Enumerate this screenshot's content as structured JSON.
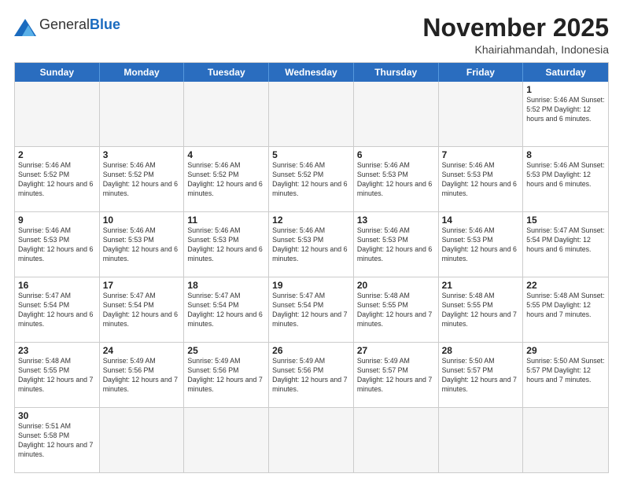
{
  "header": {
    "logo_general": "General",
    "logo_blue": "Blue",
    "month_title": "November 2025",
    "location": "Khairiahmandah, Indonesia"
  },
  "weekdays": [
    "Sunday",
    "Monday",
    "Tuesday",
    "Wednesday",
    "Thursday",
    "Friday",
    "Saturday"
  ],
  "rows": [
    [
      {
        "day": "",
        "info": "",
        "empty": true
      },
      {
        "day": "",
        "info": "",
        "empty": true
      },
      {
        "day": "",
        "info": "",
        "empty": true
      },
      {
        "day": "",
        "info": "",
        "empty": true
      },
      {
        "day": "",
        "info": "",
        "empty": true
      },
      {
        "day": "",
        "info": "",
        "empty": true
      },
      {
        "day": "1",
        "info": "Sunrise: 5:46 AM\nSunset: 5:52 PM\nDaylight: 12 hours\nand 6 minutes."
      }
    ],
    [
      {
        "day": "2",
        "info": "Sunrise: 5:46 AM\nSunset: 5:52 PM\nDaylight: 12 hours\nand 6 minutes."
      },
      {
        "day": "3",
        "info": "Sunrise: 5:46 AM\nSunset: 5:52 PM\nDaylight: 12 hours\nand 6 minutes."
      },
      {
        "day": "4",
        "info": "Sunrise: 5:46 AM\nSunset: 5:52 PM\nDaylight: 12 hours\nand 6 minutes."
      },
      {
        "day": "5",
        "info": "Sunrise: 5:46 AM\nSunset: 5:52 PM\nDaylight: 12 hours\nand 6 minutes."
      },
      {
        "day": "6",
        "info": "Sunrise: 5:46 AM\nSunset: 5:53 PM\nDaylight: 12 hours\nand 6 minutes."
      },
      {
        "day": "7",
        "info": "Sunrise: 5:46 AM\nSunset: 5:53 PM\nDaylight: 12 hours\nand 6 minutes."
      },
      {
        "day": "8",
        "info": "Sunrise: 5:46 AM\nSunset: 5:53 PM\nDaylight: 12 hours\nand 6 minutes."
      }
    ],
    [
      {
        "day": "9",
        "info": "Sunrise: 5:46 AM\nSunset: 5:53 PM\nDaylight: 12 hours\nand 6 minutes."
      },
      {
        "day": "10",
        "info": "Sunrise: 5:46 AM\nSunset: 5:53 PM\nDaylight: 12 hours\nand 6 minutes."
      },
      {
        "day": "11",
        "info": "Sunrise: 5:46 AM\nSunset: 5:53 PM\nDaylight: 12 hours\nand 6 minutes."
      },
      {
        "day": "12",
        "info": "Sunrise: 5:46 AM\nSunset: 5:53 PM\nDaylight: 12 hours\nand 6 minutes."
      },
      {
        "day": "13",
        "info": "Sunrise: 5:46 AM\nSunset: 5:53 PM\nDaylight: 12 hours\nand 6 minutes."
      },
      {
        "day": "14",
        "info": "Sunrise: 5:46 AM\nSunset: 5:53 PM\nDaylight: 12 hours\nand 6 minutes."
      },
      {
        "day": "15",
        "info": "Sunrise: 5:47 AM\nSunset: 5:54 PM\nDaylight: 12 hours\nand 6 minutes."
      }
    ],
    [
      {
        "day": "16",
        "info": "Sunrise: 5:47 AM\nSunset: 5:54 PM\nDaylight: 12 hours\nand 6 minutes."
      },
      {
        "day": "17",
        "info": "Sunrise: 5:47 AM\nSunset: 5:54 PM\nDaylight: 12 hours\nand 6 minutes."
      },
      {
        "day": "18",
        "info": "Sunrise: 5:47 AM\nSunset: 5:54 PM\nDaylight: 12 hours\nand 6 minutes."
      },
      {
        "day": "19",
        "info": "Sunrise: 5:47 AM\nSunset: 5:54 PM\nDaylight: 12 hours\nand 7 minutes."
      },
      {
        "day": "20",
        "info": "Sunrise: 5:48 AM\nSunset: 5:55 PM\nDaylight: 12 hours\nand 7 minutes."
      },
      {
        "day": "21",
        "info": "Sunrise: 5:48 AM\nSunset: 5:55 PM\nDaylight: 12 hours\nand 7 minutes."
      },
      {
        "day": "22",
        "info": "Sunrise: 5:48 AM\nSunset: 5:55 PM\nDaylight: 12 hours\nand 7 minutes."
      }
    ],
    [
      {
        "day": "23",
        "info": "Sunrise: 5:48 AM\nSunset: 5:55 PM\nDaylight: 12 hours\nand 7 minutes."
      },
      {
        "day": "24",
        "info": "Sunrise: 5:49 AM\nSunset: 5:56 PM\nDaylight: 12 hours\nand 7 minutes."
      },
      {
        "day": "25",
        "info": "Sunrise: 5:49 AM\nSunset: 5:56 PM\nDaylight: 12 hours\nand 7 minutes."
      },
      {
        "day": "26",
        "info": "Sunrise: 5:49 AM\nSunset: 5:56 PM\nDaylight: 12 hours\nand 7 minutes."
      },
      {
        "day": "27",
        "info": "Sunrise: 5:49 AM\nSunset: 5:57 PM\nDaylight: 12 hours\nand 7 minutes."
      },
      {
        "day": "28",
        "info": "Sunrise: 5:50 AM\nSunset: 5:57 PM\nDaylight: 12 hours\nand 7 minutes."
      },
      {
        "day": "29",
        "info": "Sunrise: 5:50 AM\nSunset: 5:57 PM\nDaylight: 12 hours\nand 7 minutes."
      }
    ],
    [
      {
        "day": "30",
        "info": "Sunrise: 5:51 AM\nSunset: 5:58 PM\nDaylight: 12 hours\nand 7 minutes."
      },
      {
        "day": "",
        "info": "",
        "empty": true
      },
      {
        "day": "",
        "info": "",
        "empty": true
      },
      {
        "day": "",
        "info": "",
        "empty": true
      },
      {
        "day": "",
        "info": "",
        "empty": true
      },
      {
        "day": "",
        "info": "",
        "empty": true
      },
      {
        "day": "",
        "info": "",
        "empty": true
      }
    ]
  ]
}
